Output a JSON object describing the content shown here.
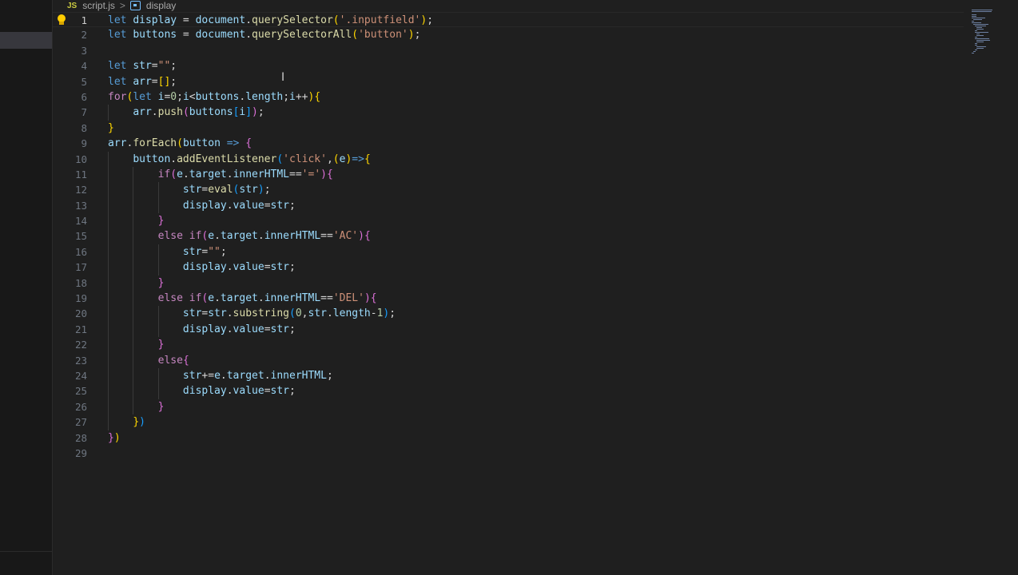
{
  "breadcrumb": {
    "file_badge": "JS",
    "file_name": "script.js",
    "separator": ">",
    "symbol_name": "display"
  },
  "editor": {
    "active_line": 1,
    "lines": [
      {
        "n": "1",
        "code": [
          [
            "kw",
            "let "
          ],
          [
            "var",
            "display"
          ],
          [
            "op",
            " = "
          ],
          [
            "var",
            "document"
          ],
          [
            "op",
            "."
          ],
          [
            "fn",
            "querySelector"
          ],
          [
            "p1",
            "("
          ],
          [
            "str",
            "'.inputfield'"
          ],
          [
            "p1",
            ")"
          ],
          [
            "op",
            ";"
          ]
        ]
      },
      {
        "n": "2",
        "code": [
          [
            "kw",
            "let "
          ],
          [
            "var",
            "buttons"
          ],
          [
            "op",
            " = "
          ],
          [
            "var",
            "document"
          ],
          [
            "op",
            "."
          ],
          [
            "fn",
            "querySelectorAll"
          ],
          [
            "p1",
            "("
          ],
          [
            "str",
            "'button'"
          ],
          [
            "p1",
            ")"
          ],
          [
            "op",
            ";"
          ]
        ]
      },
      {
        "n": "3",
        "code": []
      },
      {
        "n": "4",
        "code": [
          [
            "kw",
            "let "
          ],
          [
            "var",
            "str"
          ],
          [
            "op",
            "="
          ],
          [
            "str",
            "\"\""
          ],
          [
            "op",
            ";"
          ]
        ]
      },
      {
        "n": "5",
        "code": [
          [
            "kw",
            "let "
          ],
          [
            "var",
            "arr"
          ],
          [
            "op",
            "="
          ],
          [
            "p1",
            "[]"
          ],
          [
            "op",
            ";"
          ]
        ]
      },
      {
        "n": "6",
        "code": [
          [
            "ctl",
            "for"
          ],
          [
            "p1",
            "("
          ],
          [
            "kw",
            "let "
          ],
          [
            "var",
            "i"
          ],
          [
            "op",
            "="
          ],
          [
            "num",
            "0"
          ],
          [
            "op",
            ";"
          ],
          [
            "var",
            "i"
          ],
          [
            "op",
            "<"
          ],
          [
            "var",
            "buttons"
          ],
          [
            "op",
            "."
          ],
          [
            "var",
            "length"
          ],
          [
            "op",
            ";"
          ],
          [
            "var",
            "i"
          ],
          [
            "op",
            "++"
          ],
          [
            "p1",
            ")"
          ],
          [
            "p1",
            "{"
          ]
        ]
      },
      {
        "n": "7",
        "code": [
          [
            "op",
            "    "
          ],
          [
            "var",
            "arr"
          ],
          [
            "op",
            "."
          ],
          [
            "fn",
            "push"
          ],
          [
            "p2",
            "("
          ],
          [
            "var",
            "buttons"
          ],
          [
            "p3",
            "["
          ],
          [
            "var",
            "i"
          ],
          [
            "p3",
            "]"
          ],
          [
            "p2",
            ")"
          ],
          [
            "op",
            ";"
          ]
        ]
      },
      {
        "n": "8",
        "code": [
          [
            "p1",
            "}"
          ]
        ]
      },
      {
        "n": "9",
        "code": [
          [
            "var",
            "arr"
          ],
          [
            "op",
            "."
          ],
          [
            "fn",
            "forEach"
          ],
          [
            "p1",
            "("
          ],
          [
            "var",
            "button"
          ],
          [
            "kw",
            " => "
          ],
          [
            "p2",
            "{"
          ]
        ]
      },
      {
        "n": "10",
        "code": [
          [
            "op",
            "    "
          ],
          [
            "var",
            "button"
          ],
          [
            "op",
            "."
          ],
          [
            "fn",
            "addEventListener"
          ],
          [
            "p3",
            "("
          ],
          [
            "str",
            "'click'"
          ],
          [
            "op",
            ","
          ],
          [
            "p1",
            "("
          ],
          [
            "var",
            "e"
          ],
          [
            "p1",
            ")"
          ],
          [
            "kw",
            "=>"
          ],
          [
            "p1",
            "{"
          ]
        ]
      },
      {
        "n": "11",
        "code": [
          [
            "op",
            "        "
          ],
          [
            "ctl",
            "if"
          ],
          [
            "p2",
            "("
          ],
          [
            "var",
            "e"
          ],
          [
            "op",
            "."
          ],
          [
            "var",
            "target"
          ],
          [
            "op",
            "."
          ],
          [
            "var",
            "innerHTML"
          ],
          [
            "op",
            "=="
          ],
          [
            "str",
            "'='"
          ],
          [
            "p2",
            ")"
          ],
          [
            "p2",
            "{"
          ]
        ]
      },
      {
        "n": "12",
        "code": [
          [
            "op",
            "            "
          ],
          [
            "var",
            "str"
          ],
          [
            "op",
            "="
          ],
          [
            "fn",
            "eval"
          ],
          [
            "p3",
            "("
          ],
          [
            "var",
            "str"
          ],
          [
            "p3",
            ")"
          ],
          [
            "op",
            ";"
          ]
        ]
      },
      {
        "n": "13",
        "code": [
          [
            "op",
            "            "
          ],
          [
            "var",
            "display"
          ],
          [
            "op",
            "."
          ],
          [
            "var",
            "value"
          ],
          [
            "op",
            "="
          ],
          [
            "var",
            "str"
          ],
          [
            "op",
            ";"
          ]
        ]
      },
      {
        "n": "14",
        "code": [
          [
            "op",
            "        "
          ],
          [
            "p2",
            "}"
          ]
        ]
      },
      {
        "n": "15",
        "code": [
          [
            "op",
            "        "
          ],
          [
            "ctl",
            "else if"
          ],
          [
            "p2",
            "("
          ],
          [
            "var",
            "e"
          ],
          [
            "op",
            "."
          ],
          [
            "var",
            "target"
          ],
          [
            "op",
            "."
          ],
          [
            "var",
            "innerHTML"
          ],
          [
            "op",
            "=="
          ],
          [
            "str",
            "'AC'"
          ],
          [
            "p2",
            ")"
          ],
          [
            "p2",
            "{"
          ]
        ]
      },
      {
        "n": "16",
        "code": [
          [
            "op",
            "            "
          ],
          [
            "var",
            "str"
          ],
          [
            "op",
            "="
          ],
          [
            "str",
            "\"\""
          ],
          [
            "op",
            ";"
          ]
        ]
      },
      {
        "n": "17",
        "code": [
          [
            "op",
            "            "
          ],
          [
            "var",
            "display"
          ],
          [
            "op",
            "."
          ],
          [
            "var",
            "value"
          ],
          [
            "op",
            "="
          ],
          [
            "var",
            "str"
          ],
          [
            "op",
            ";"
          ]
        ]
      },
      {
        "n": "18",
        "code": [
          [
            "op",
            "        "
          ],
          [
            "p2",
            "}"
          ]
        ]
      },
      {
        "n": "19",
        "code": [
          [
            "op",
            "        "
          ],
          [
            "ctl",
            "else if"
          ],
          [
            "p2",
            "("
          ],
          [
            "var",
            "e"
          ],
          [
            "op",
            "."
          ],
          [
            "var",
            "target"
          ],
          [
            "op",
            "."
          ],
          [
            "var",
            "innerHTML"
          ],
          [
            "op",
            "=="
          ],
          [
            "str",
            "'DEL'"
          ],
          [
            "p2",
            ")"
          ],
          [
            "p2",
            "{"
          ]
        ]
      },
      {
        "n": "20",
        "code": [
          [
            "op",
            "            "
          ],
          [
            "var",
            "str"
          ],
          [
            "op",
            "="
          ],
          [
            "var",
            "str"
          ],
          [
            "op",
            "."
          ],
          [
            "fn",
            "substring"
          ],
          [
            "p3",
            "("
          ],
          [
            "num",
            "0"
          ],
          [
            "op",
            ","
          ],
          [
            "var",
            "str"
          ],
          [
            "op",
            "."
          ],
          [
            "var",
            "length"
          ],
          [
            "op",
            "-"
          ],
          [
            "num",
            "1"
          ],
          [
            "p3",
            ")"
          ],
          [
            "op",
            ";"
          ]
        ]
      },
      {
        "n": "21",
        "code": [
          [
            "op",
            "            "
          ],
          [
            "var",
            "display"
          ],
          [
            "op",
            "."
          ],
          [
            "var",
            "value"
          ],
          [
            "op",
            "="
          ],
          [
            "var",
            "str"
          ],
          [
            "op",
            ";"
          ]
        ]
      },
      {
        "n": "22",
        "code": [
          [
            "op",
            "        "
          ],
          [
            "p2",
            "}"
          ]
        ]
      },
      {
        "n": "23",
        "code": [
          [
            "op",
            "        "
          ],
          [
            "ctl",
            "else"
          ],
          [
            "p2",
            "{"
          ]
        ]
      },
      {
        "n": "24",
        "code": [
          [
            "op",
            "            "
          ],
          [
            "var",
            "str"
          ],
          [
            "op",
            "+="
          ],
          [
            "var",
            "e"
          ],
          [
            "op",
            "."
          ],
          [
            "var",
            "target"
          ],
          [
            "op",
            "."
          ],
          [
            "var",
            "innerHTML"
          ],
          [
            "op",
            ";"
          ]
        ]
      },
      {
        "n": "25",
        "code": [
          [
            "op",
            "            "
          ],
          [
            "var",
            "display"
          ],
          [
            "op",
            "."
          ],
          [
            "var",
            "value"
          ],
          [
            "op",
            "="
          ],
          [
            "var",
            "str"
          ],
          [
            "op",
            ";"
          ]
        ]
      },
      {
        "n": "26",
        "code": [
          [
            "op",
            "        "
          ],
          [
            "p2",
            "}"
          ]
        ]
      },
      {
        "n": "27",
        "code": [
          [
            "op",
            "    "
          ],
          [
            "p1",
            "}"
          ],
          [
            "p3",
            ")"
          ]
        ]
      },
      {
        "n": "28",
        "code": [
          [
            "p2",
            "}"
          ],
          [
            "p1",
            ")"
          ]
        ]
      },
      {
        "n": "29",
        "code": []
      }
    ]
  },
  "colors": {
    "background": "#1f1f1f",
    "keyword": "#569cd6",
    "control": "#c586c0",
    "variable": "#9cdcfe",
    "function": "#dcdcaa",
    "string": "#ce9178",
    "number": "#b5cea8"
  },
  "icons": [
    "lightbulb-icon",
    "symbol-variable-icon",
    "text-cursor-icon"
  ]
}
